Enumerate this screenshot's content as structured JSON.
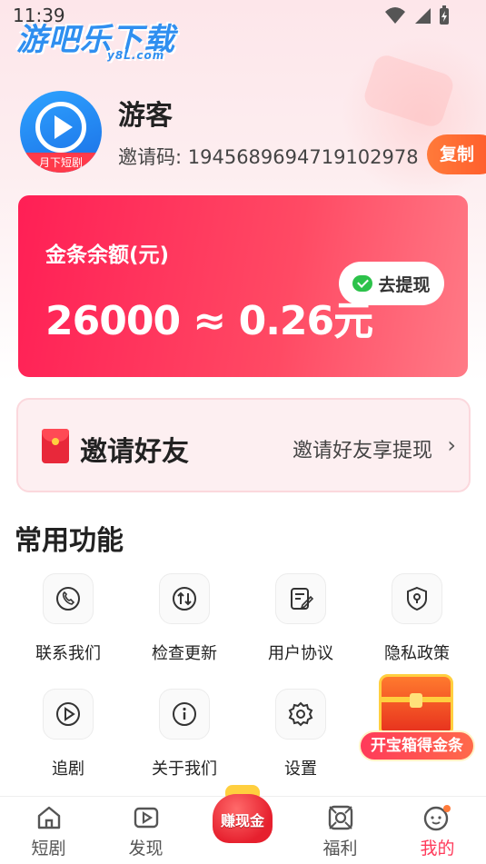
{
  "status_bar": {
    "time": "11:39"
  },
  "watermark": {
    "main": "游吧乐下载",
    "sub": "y8L.com"
  },
  "profile": {
    "avatar_ribbon": "月下短剧",
    "name": "游客",
    "invite_code": "邀请码: 1945689694719102978",
    "copy_label": "复制"
  },
  "balance": {
    "label": "金条余额(元)",
    "value": "26000 ≈ 0.26元",
    "withdraw_label": "去提现"
  },
  "invite": {
    "title": "邀请好友",
    "subtitle": "邀请好友享提现"
  },
  "functions": {
    "title": "常用功能",
    "items": [
      {
        "label": "联系我们",
        "icon": "phone-icon"
      },
      {
        "label": "检查更新",
        "icon": "update-icon"
      },
      {
        "label": "用户协议",
        "icon": "agreement-icon"
      },
      {
        "label": "隐私政策",
        "icon": "privacy-icon"
      },
      {
        "label": "追剧",
        "icon": "play-icon"
      },
      {
        "label": "关于我们",
        "icon": "info-icon"
      },
      {
        "label": "设置",
        "icon": "gear-icon"
      }
    ]
  },
  "treasure": {
    "label": "开宝箱得金条"
  },
  "bottom_nav": {
    "items": [
      {
        "label": "短剧",
        "icon": "home-icon",
        "active": false
      },
      {
        "label": "发现",
        "icon": "discover-icon",
        "active": false
      },
      {
        "label": "赚现金",
        "icon": "money-bag-icon",
        "active": false
      },
      {
        "label": "福利",
        "icon": "welfare-icon",
        "active": false
      },
      {
        "label": "我的",
        "icon": "profile-icon",
        "active": true
      }
    ]
  },
  "colors": {
    "accent": "#ff3a5a",
    "balance_card": "#ff1f55",
    "copy_button": "#ff6a3a"
  }
}
